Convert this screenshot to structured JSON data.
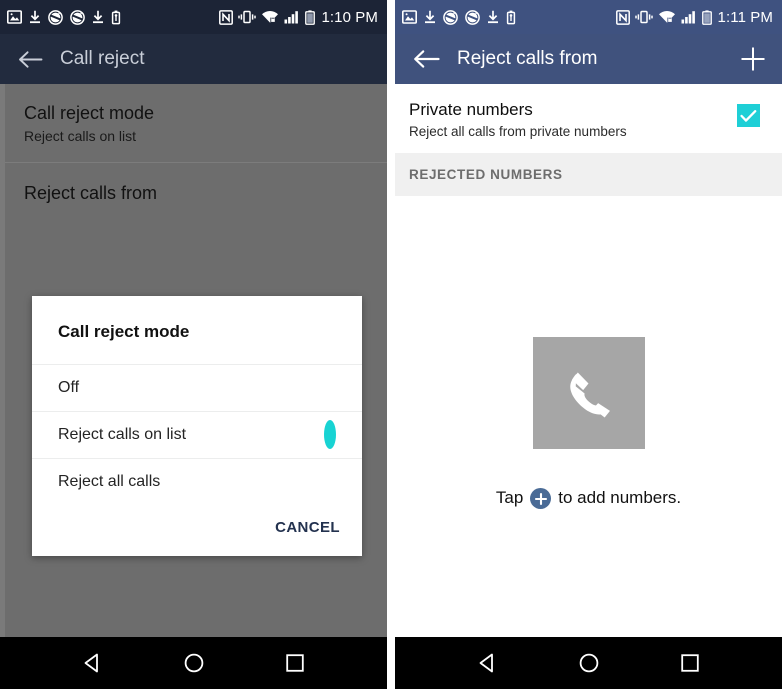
{
  "left_screen": {
    "status_bar": {
      "time": "1:10 PM",
      "left_icons": [
        "image-icon",
        "download-icon",
        "sync-icon",
        "sync-icon",
        "download-icon",
        "usb-icon"
      ],
      "right_icons": [
        "nfc-icon",
        "vibrate-icon",
        "wifi-secure-icon",
        "signal-bars-icon",
        "battery-icon"
      ],
      "background_color": "#1c2436"
    },
    "app_bar": {
      "back_icon": "arrow-left-icon",
      "title": "Call reject",
      "background_color": "#222b3e"
    },
    "settings": [
      {
        "title": "Call reject mode",
        "subtitle": "Reject calls on list"
      },
      {
        "title": "Reject calls from",
        "subtitle": ""
      }
    ],
    "dialog": {
      "title": "Call reject mode",
      "options": [
        {
          "label": "Off",
          "selected": false
        },
        {
          "label": "Reject calls on list",
          "selected": true
        },
        {
          "label": "Reject all calls",
          "selected": false
        }
      ],
      "cancel_label": "CANCEL",
      "accent_color": "#18d3d3",
      "cancel_color": "#23324f"
    },
    "nav_bar": {
      "back": "nav-back-triangle-icon",
      "home": "nav-home-circle-icon",
      "recents": "nav-recents-square-icon"
    }
  },
  "right_screen": {
    "status_bar": {
      "time": "1:11 PM",
      "left_icons": [
        "image-icon",
        "download-icon",
        "sync-icon",
        "sync-icon",
        "download-icon",
        "usb-icon"
      ],
      "right_icons": [
        "nfc-icon",
        "vibrate-icon",
        "wifi-secure-icon",
        "signal-bars-icon",
        "battery-icon"
      ],
      "background_color": "#3f5280"
    },
    "app_bar": {
      "back_icon": "arrow-left-icon",
      "title": "Reject calls from",
      "add_icon": "plus-icon",
      "background_color": "#40527d"
    },
    "private_numbers": {
      "title": "Private numbers",
      "subtitle": "Reject all calls from private numbers",
      "checked": true,
      "checkbox_color": "#1ecfd6"
    },
    "section_header": "REJECTED NUMBERS",
    "empty_state": {
      "icon": "phone-handset-icon",
      "icon_bg_color": "#a6a6a6",
      "text_before": "Tap",
      "badge_icon": "plus-circle-icon",
      "text_after": "to add numbers.",
      "badge_color": "#4a6b96"
    },
    "nav_bar": {
      "back": "nav-back-triangle-icon",
      "home": "nav-home-circle-icon",
      "recents": "nav-recents-square-icon"
    }
  }
}
